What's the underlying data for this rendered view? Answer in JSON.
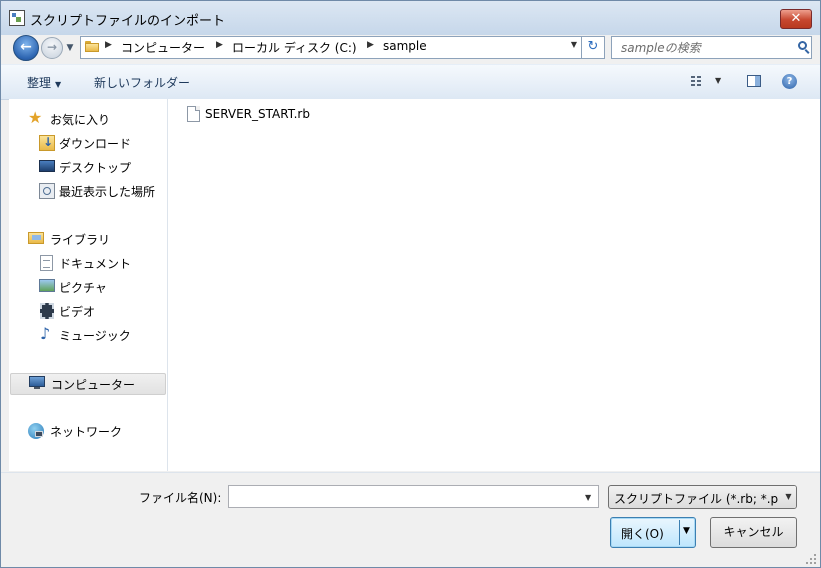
{
  "window": {
    "title": "スクリプトファイルのインポート",
    "close_glyph": "✕"
  },
  "nav": {
    "back_glyph": "←",
    "forward_glyph": "→",
    "recent_glyph": "▼",
    "breadcrumb": [
      "コンピューター",
      "ローカル ディスク (C:)",
      "sample"
    ],
    "separator_glyph": "▶",
    "dropdown_glyph": "▼",
    "refresh_glyph": "↻",
    "search_placeholder": "sampleの検索"
  },
  "toolbar": {
    "organize_label": "整理",
    "organize_arrow": "▼",
    "new_folder_label": "新しいフォルダー",
    "view_arrow": "▼",
    "help_glyph": "?"
  },
  "sidebar": {
    "favorites": {
      "label": "お気に入り",
      "icon": "star-icon",
      "star_glyph": "★"
    },
    "favorites_items": [
      {
        "label": "ダウンロード",
        "icon": "download-folder-icon"
      },
      {
        "label": "デスクトップ",
        "icon": "desktop-icon"
      },
      {
        "label": "最近表示した場所",
        "icon": "recent-places-icon"
      }
    ],
    "libraries": {
      "label": "ライブラリ",
      "icon": "library-icon"
    },
    "library_items": [
      {
        "label": "ドキュメント",
        "icon": "document-icon"
      },
      {
        "label": "ピクチャ",
        "icon": "picture-icon"
      },
      {
        "label": "ビデオ",
        "icon": "video-icon"
      },
      {
        "label": "ミュージック",
        "icon": "music-icon",
        "glyph": "♪"
      }
    ],
    "computer": {
      "label": "コンピューター",
      "icon": "computer-icon"
    },
    "network": {
      "label": "ネットワーク",
      "icon": "network-icon"
    }
  },
  "files": [
    {
      "name": "SERVER_START.rb",
      "icon": "file-icon"
    }
  ],
  "bottom": {
    "filename_label": "ファイル名(N):",
    "filename_value": "",
    "filename_dropdown_glyph": "▼",
    "filter_value": "スクリプトファイル (*.rb; *.p",
    "filter_dropdown_glyph": "▼",
    "open_label": "開く(O)",
    "open_dropdown_glyph": "▼",
    "cancel_label": "キャンセル"
  },
  "colors": {
    "accent": "#2d62a8",
    "title_bar": "#c6d7ea",
    "close": "#c7472f"
  }
}
